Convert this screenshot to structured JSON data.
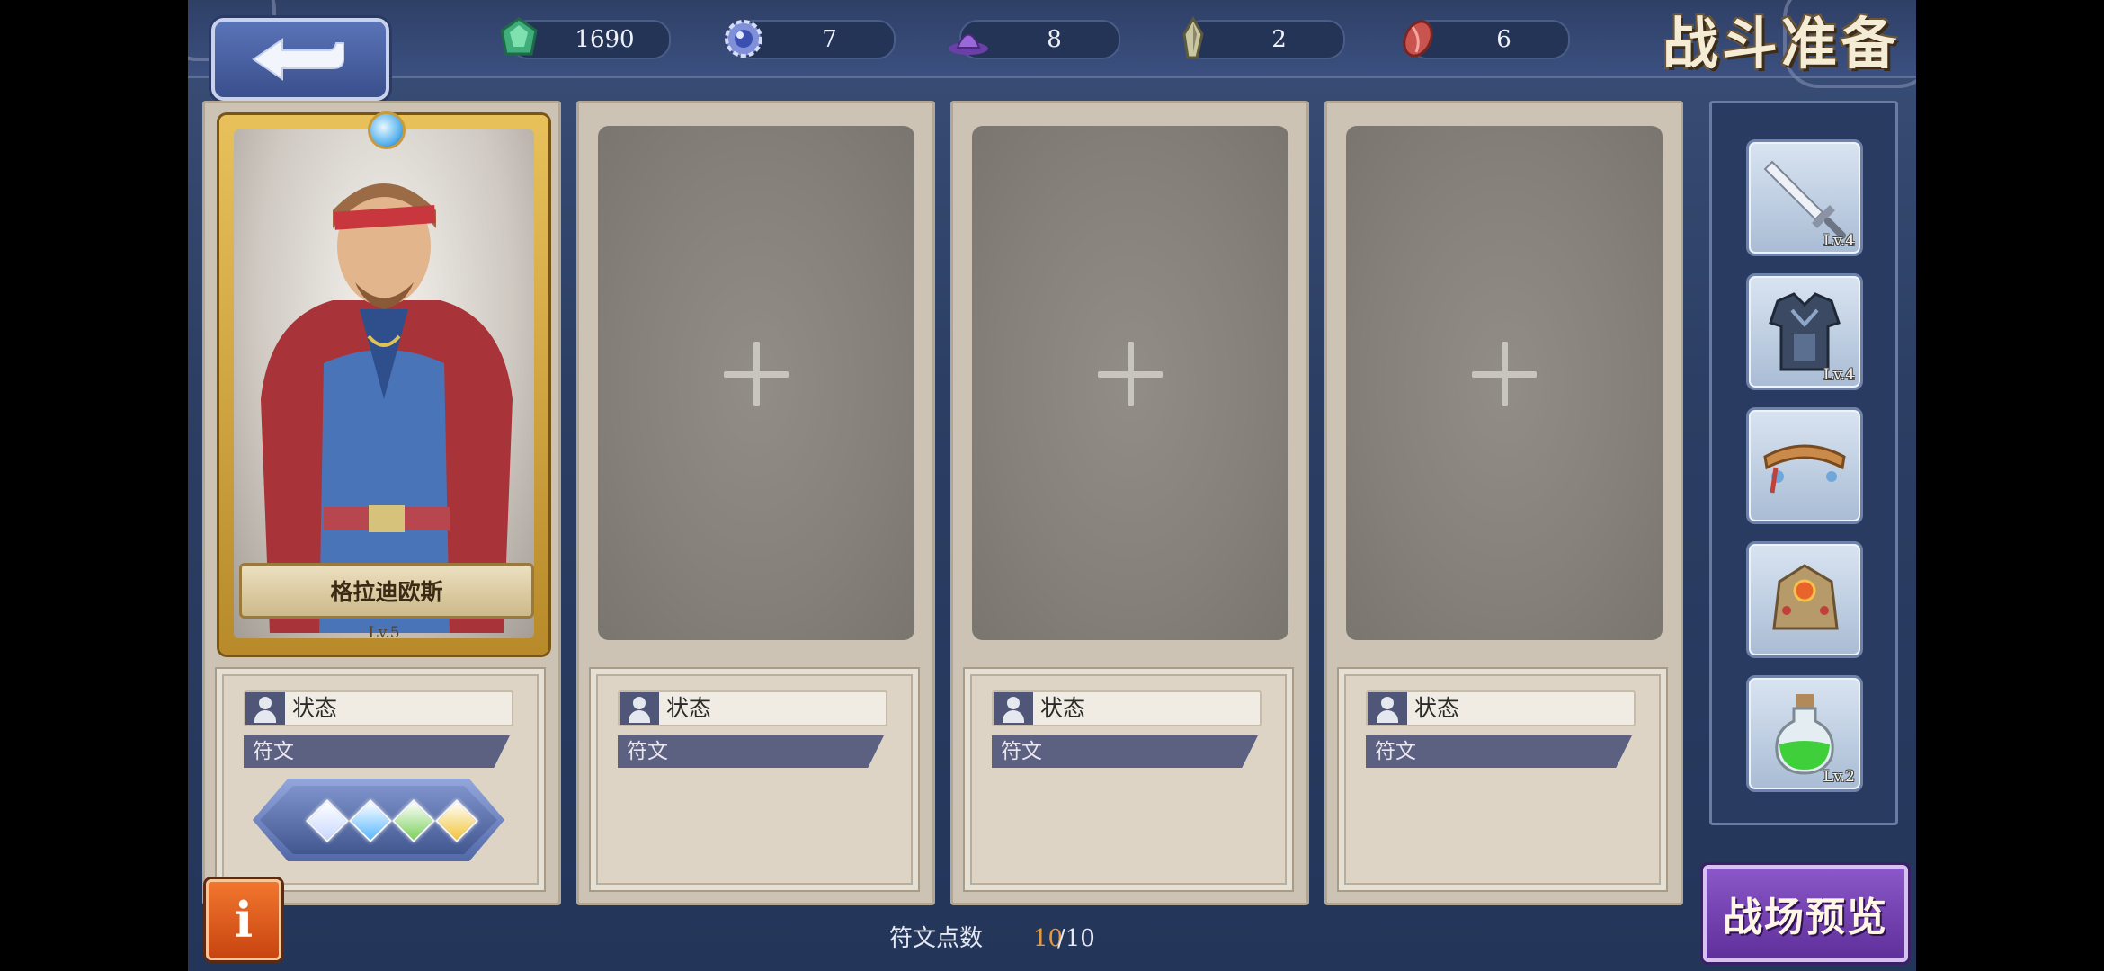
{
  "title": "战斗准备",
  "resources": [
    {
      "name": "emerald-crystal-icon",
      "value": "1690"
    },
    {
      "name": "blue-gear-orb-icon",
      "value": "7"
    },
    {
      "name": "purple-hat-icon",
      "value": "8"
    },
    {
      "name": "stone-shard-icon",
      "value": "2"
    },
    {
      "name": "red-bean-icon",
      "value": "6"
    }
  ],
  "hero": {
    "name": "格拉迪欧斯",
    "level": "Lv.5"
  },
  "slots": [
    {
      "status_label": "状态",
      "rune_label": "符文"
    },
    {
      "status_label": "状态",
      "rune_label": "符文"
    },
    {
      "status_label": "状态",
      "rune_label": "符文"
    },
    {
      "status_label": "状态",
      "rune_label": "符文"
    }
  ],
  "rune_gems": [
    "#c9d8ff",
    "#58b7ff",
    "#7bd05a",
    "#f2c43a"
  ],
  "equipment": [
    {
      "icon": "sword-icon",
      "level": "Lv.4"
    },
    {
      "icon": "armor-icon",
      "level": "Lv.4"
    },
    {
      "icon": "headband-icon",
      "level": ""
    },
    {
      "icon": "gauntlet-icon",
      "level": ""
    },
    {
      "icon": "green-potion-icon",
      "level": "Lv.2"
    }
  ],
  "rune_points": {
    "label": "符文点数",
    "current": "10",
    "max": "/10"
  },
  "preview_button": "战场预览",
  "info_button": "i",
  "colors": {
    "accent_purple": "#6a38a8",
    "info_orange": "#e0601e",
    "rune_point_current": "#e29a3a"
  }
}
